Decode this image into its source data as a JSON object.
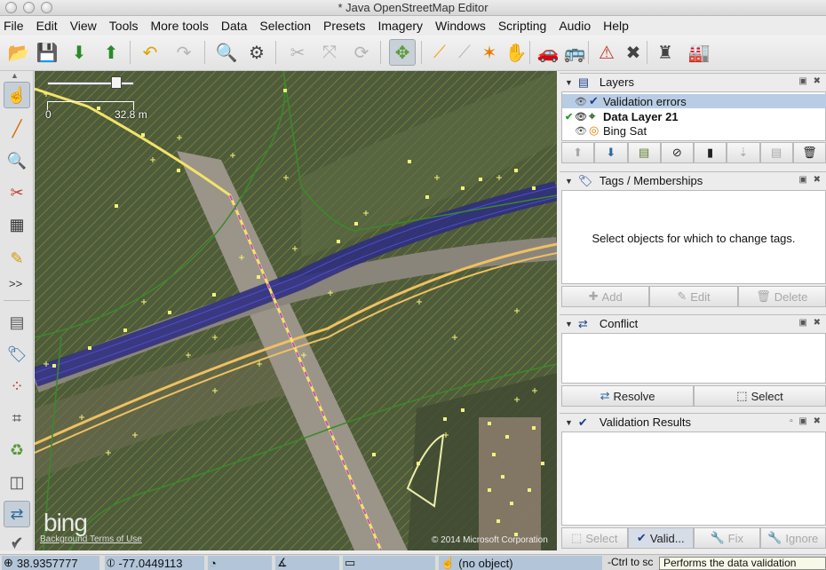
{
  "window": {
    "title": "* Java OpenStreetMap Editor"
  },
  "menu": [
    "File",
    "Edit",
    "View",
    "Tools",
    "More tools",
    "Data",
    "Selection",
    "Presets",
    "Imagery",
    "Windows",
    "Scripting",
    "Audio",
    "Help"
  ],
  "map": {
    "scale_start": "0",
    "scale_end": "32.8 m",
    "provider_logo": "bing",
    "terms_link": "Background Terms of Use",
    "copyright": "© 2014 Microsoft Corporation"
  },
  "layers": {
    "title": "Layers",
    "items": [
      {
        "label": "Validation errors",
        "selected": true,
        "active": false
      },
      {
        "label": "Data Layer 21",
        "selected": false,
        "active": true
      },
      {
        "label": "Bing Sat",
        "selected": false,
        "active": false
      }
    ]
  },
  "tags": {
    "title": "Tags / Memberships",
    "empty_message": "Select objects for which to change tags.",
    "add_label": "Add",
    "edit_label": "Edit",
    "delete_label": "Delete"
  },
  "conflict": {
    "title": "Conflict",
    "resolve_label": "Resolve",
    "select_label": "Select"
  },
  "validation": {
    "title": "Validation Results",
    "select_label": "Select",
    "validate_label": "Valid...",
    "fix_label": "Fix",
    "ignore_label": "Ignore"
  },
  "status": {
    "lat": "38.9357777",
    "lon": "-77.0449113",
    "object": "(no object)",
    "hint": "-Ctrl to sc"
  },
  "tooltip": "Performs the data validation"
}
